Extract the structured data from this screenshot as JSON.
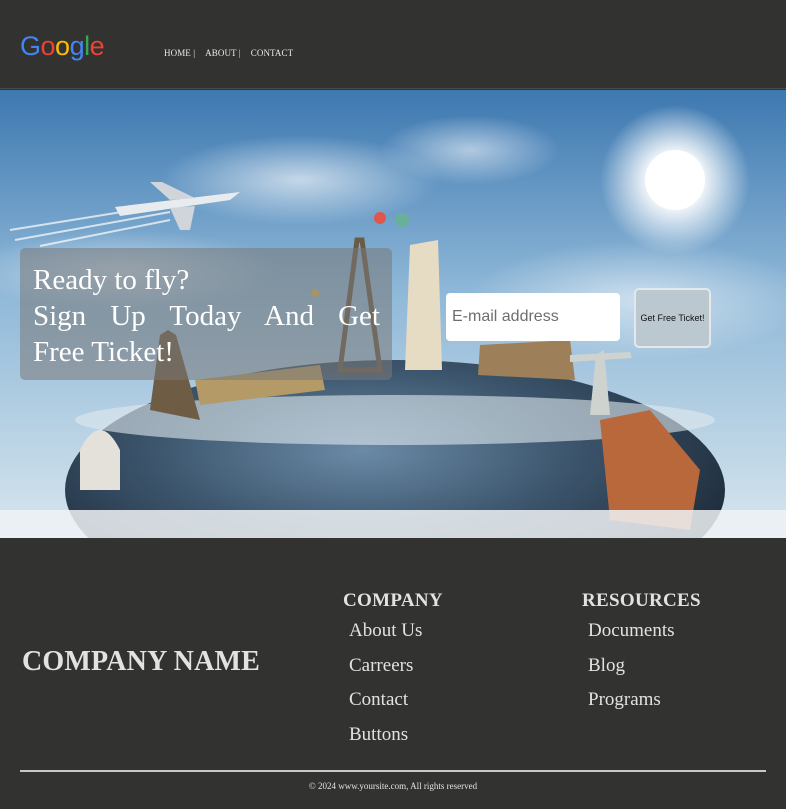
{
  "header": {
    "logo_letters": [
      {
        "char": "G",
        "color": "#4285F4"
      },
      {
        "char": "o",
        "color": "#EA4335"
      },
      {
        "char": "o",
        "color": "#FBBC05"
      },
      {
        "char": "g",
        "color": "#4285F4"
      },
      {
        "char": "l",
        "color": "#34A853"
      },
      {
        "char": "e",
        "color": "#EA4335"
      }
    ],
    "nav": [
      "HOME |",
      "ABOUT |",
      "CONTACT"
    ]
  },
  "hero": {
    "line1": "Ready to fly?",
    "line2": "Sign Up Today And Get",
    "line3": "Free Ticket!",
    "email_placeholder": "E-mail address",
    "button_label": "Get Free Ticket!"
  },
  "footer": {
    "company_name": "COMPANY NAME",
    "company": {
      "heading": "COMPANY",
      "links": [
        "About Us",
        "Carreers",
        "Contact",
        "Buttons"
      ]
    },
    "resources": {
      "heading": "RESOURCES",
      "links": [
        "Documents",
        "Blog",
        "Programs"
      ]
    },
    "copyright": "© 2024 www.yoursite.com, All rights reserved"
  },
  "colors": {
    "background": "#323330",
    "text_light": "#e2e2e2"
  }
}
